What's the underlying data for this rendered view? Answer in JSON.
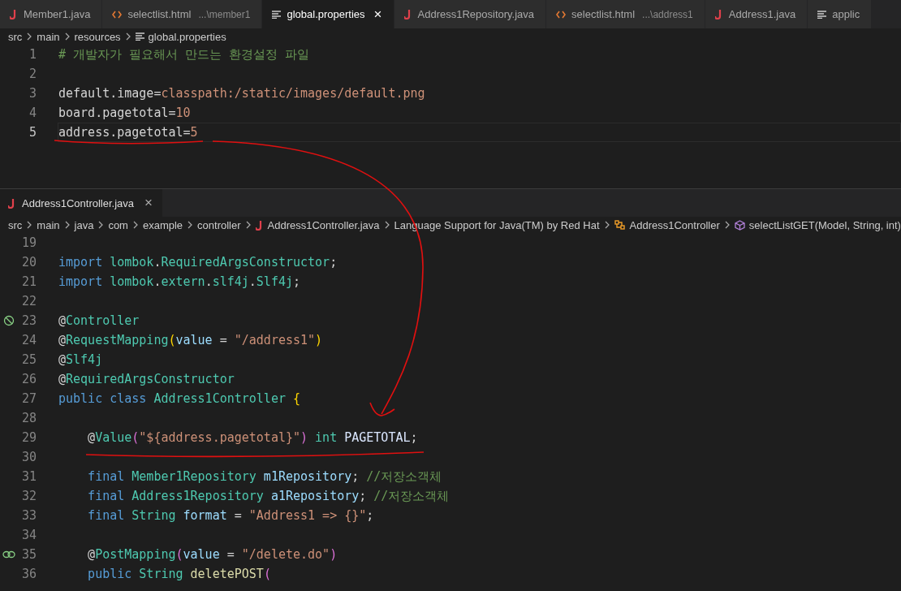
{
  "editor_tabs": [
    {
      "label": "Member1.java",
      "kind": "java",
      "selected": false
    },
    {
      "label": "selectlist.html",
      "detail": "...\\member1",
      "kind": "html",
      "selected": false
    },
    {
      "label": "global.properties",
      "kind": "props",
      "selected": true,
      "close": "×"
    },
    {
      "label": "Address1Repository.java",
      "kind": "java",
      "selected": false
    },
    {
      "label": "selectlist.html",
      "detail": "...\\address1",
      "kind": "html",
      "selected": false
    },
    {
      "label": "Address1.java",
      "kind": "java",
      "selected": false
    },
    {
      "label": "applic",
      "kind": "props",
      "selected": false
    }
  ],
  "top_breadcrumb": [
    {
      "label": "src"
    },
    {
      "label": "main"
    },
    {
      "label": "resources"
    },
    {
      "label": "global.properties",
      "kind": "props"
    }
  ],
  "top_editor": {
    "lines": [
      {
        "number": "1",
        "current": false,
        "tokens": [
          {
            "text": "# 개발자가 필요해서 만드는 환경설정 파일",
            "kind": "comment"
          }
        ]
      },
      {
        "number": "2",
        "current": false
      },
      {
        "number": "3",
        "current": false,
        "tokens": [
          {
            "text": "default.image=",
            "kind": "plain"
          },
          {
            "text": "classpath:/static/images/default.png",
            "kind": "str"
          }
        ]
      },
      {
        "number": "4",
        "current": false,
        "tokens": [
          {
            "text": "board.pagetotal=",
            "kind": "plain"
          },
          {
            "text": "10",
            "kind": "str"
          }
        ]
      },
      {
        "number": "5",
        "current": true,
        "tokens": [
          {
            "text": "address.pagetotal=",
            "kind": "plain"
          },
          {
            "text": "5",
            "kind": "str"
          }
        ]
      }
    ]
  },
  "bottom_panel": {
    "tab": {
      "label": "Address1Controller.java",
      "kind": "java",
      "close": "×"
    },
    "breadcrumb": [
      {
        "label": "src"
      },
      {
        "label": "main"
      },
      {
        "label": "java"
      },
      {
        "label": "com"
      },
      {
        "label": "example"
      },
      {
        "label": "controller"
      },
      {
        "label": "Address1Controller.java",
        "kind": "java"
      },
      {
        "label": "Language Support for Java(TM) by Red Hat"
      },
      {
        "label": "Address1Controller",
        "kind": "class"
      },
      {
        "label": "selectListGET(Model, String, int)",
        "kind": "method"
      }
    ],
    "lines": [
      {
        "number": "19"
      },
      {
        "number": "20",
        "tokens": [
          {
            "text": "import",
            "kind": "kw"
          },
          {
            "text": " lombok",
            "kind": "type"
          },
          {
            "text": ".",
            "kind": "plain"
          },
          {
            "text": "RequiredArgsConstructor",
            "kind": "type"
          },
          {
            "text": ";",
            "kind": "plain"
          }
        ]
      },
      {
        "number": "21",
        "tokens": [
          {
            "text": "import",
            "kind": "kw"
          },
          {
            "text": " lombok",
            "kind": "type"
          },
          {
            "text": ".",
            "kind": "plain"
          },
          {
            "text": "extern",
            "kind": "type"
          },
          {
            "text": ".",
            "kind": "plain"
          },
          {
            "text": "slf4j",
            "kind": "type"
          },
          {
            "text": ".",
            "kind": "plain"
          },
          {
            "text": "Slf4j",
            "kind": "type"
          },
          {
            "text": ";",
            "kind": "plain"
          }
        ]
      },
      {
        "number": "22"
      },
      {
        "number": "23",
        "gutter": {
          "kind": "no-entry"
        },
        "tokens": [
          {
            "text": "@",
            "kind": "plain"
          },
          {
            "text": "Controller",
            "kind": "type"
          }
        ]
      },
      {
        "number": "24",
        "tokens": [
          {
            "text": "@",
            "kind": "plain"
          },
          {
            "text": "RequestMapping",
            "kind": "type"
          },
          {
            "text": "(",
            "kind": "bracket"
          },
          {
            "text": "value",
            "kind": "var"
          },
          {
            "text": " = ",
            "kind": "plain"
          },
          {
            "text": "\"/address1\"",
            "kind": "str"
          },
          {
            "text": ")",
            "kind": "bracket"
          }
        ]
      },
      {
        "number": "25",
        "tokens": [
          {
            "text": "@",
            "kind": "plain"
          },
          {
            "text": "Slf4j",
            "kind": "type"
          }
        ]
      },
      {
        "number": "26",
        "tokens": [
          {
            "text": "@",
            "kind": "plain"
          },
          {
            "text": "RequiredArgsConstructor",
            "kind": "type"
          }
        ]
      },
      {
        "number": "27",
        "tokens": [
          {
            "text": "public",
            "kind": "kw"
          },
          {
            "text": " class",
            "kind": "kw"
          },
          {
            "text": " Address1Controller",
            "kind": "type"
          },
          {
            "text": " {",
            "kind": "bracket"
          }
        ]
      },
      {
        "number": "28"
      },
      {
        "number": "29",
        "tokens": [
          {
            "text": "    @",
            "kind": "plain"
          },
          {
            "text": "Value",
            "kind": "type"
          },
          {
            "text": "(",
            "kind": "bracket2"
          },
          {
            "text": "\"${address.pagetotal}\"",
            "kind": "str"
          },
          {
            "text": ")",
            "kind": "bracket2"
          },
          {
            "text": " int",
            "kind": "type"
          },
          {
            "text": " PAGETOTAL",
            "kind": "const"
          },
          {
            "text": ";",
            "kind": "plain"
          }
        ]
      },
      {
        "number": "30"
      },
      {
        "number": "31",
        "tokens": [
          {
            "text": "    final",
            "kind": "kw"
          },
          {
            "text": " Member1Repository",
            "kind": "type"
          },
          {
            "text": " m1Repository",
            "kind": "var"
          },
          {
            "text": "; ",
            "kind": "plain"
          },
          {
            "text": "//저장소객체",
            "kind": "comment"
          }
        ]
      },
      {
        "number": "32",
        "tokens": [
          {
            "text": "    final",
            "kind": "kw"
          },
          {
            "text": " Address1Repository",
            "kind": "type"
          },
          {
            "text": " a1Repository",
            "kind": "var"
          },
          {
            "text": "; ",
            "kind": "plain"
          },
          {
            "text": "//저장소객체",
            "kind": "comment"
          }
        ]
      },
      {
        "number": "33",
        "tokens": [
          {
            "text": "    final",
            "kind": "kw"
          },
          {
            "text": " String",
            "kind": "type"
          },
          {
            "text": " format",
            "kind": "var"
          },
          {
            "text": " = ",
            "kind": "plain"
          },
          {
            "text": "\"Address1 => {}\"",
            "kind": "str"
          },
          {
            "text": ";",
            "kind": "plain"
          }
        ]
      },
      {
        "number": "34"
      },
      {
        "number": "35",
        "gutter": {
          "kind": "link"
        },
        "tokens": [
          {
            "text": "    @",
            "kind": "plain"
          },
          {
            "text": "PostMapping",
            "kind": "type"
          },
          {
            "text": "(",
            "kind": "bracket2"
          },
          {
            "text": "value",
            "kind": "var"
          },
          {
            "text": " = ",
            "kind": "plain"
          },
          {
            "text": "\"/delete.do\"",
            "kind": "str"
          },
          {
            "text": ")",
            "kind": "bracket2"
          }
        ]
      },
      {
        "number": "36",
        "tokens": [
          {
            "text": "    public",
            "kind": "kw"
          },
          {
            "text": " String",
            "kind": "type"
          },
          {
            "text": " deletePOST",
            "kind": "fn"
          },
          {
            "text": "(",
            "kind": "bracket2"
          }
        ]
      }
    ]
  }
}
